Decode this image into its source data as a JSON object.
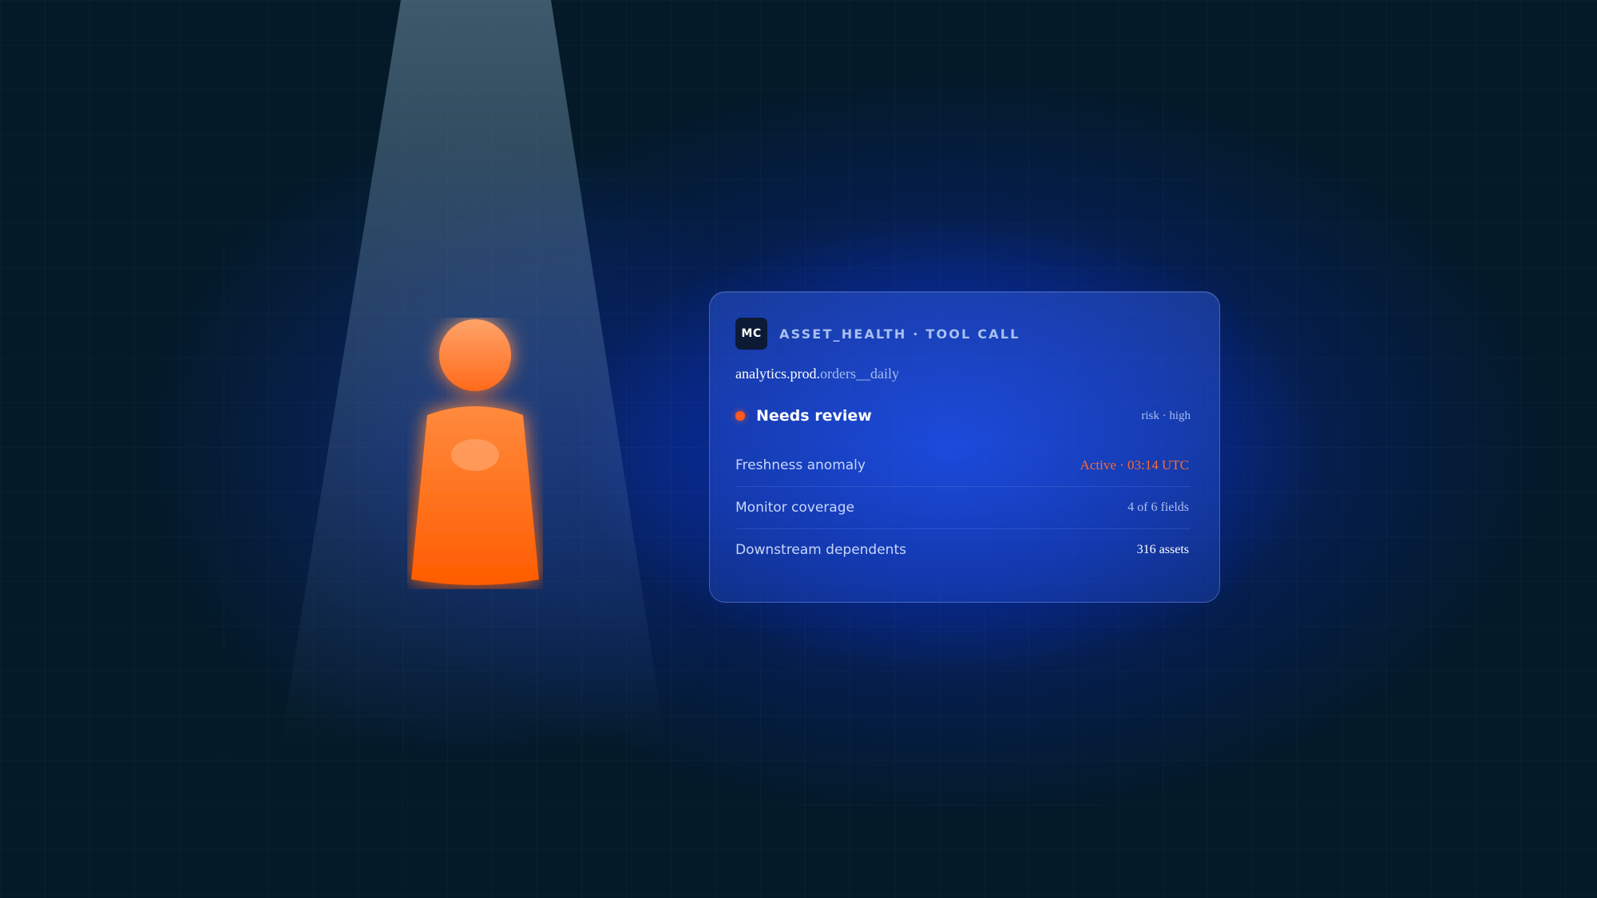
{
  "card": {
    "badge": "MC",
    "tool_title": "ASSET_HEALTH · TOOL CALL",
    "asset_prefix": "analytics.prod.",
    "asset_table": "orders__daily",
    "status": {
      "label": "Needs review",
      "risk": "risk · high",
      "dot_color": "#ff5a1f"
    },
    "rows": [
      {
        "label": "Freshness anomaly",
        "value": "Active · 03:14 UTC"
      },
      {
        "label": "Monitor coverage",
        "value": "4 of 6 fields"
      },
      {
        "label": "Downstream dependents",
        "value": "316 assets"
      }
    ]
  },
  "colors": {
    "accent_orange": "#ff6a1a",
    "background": "#041a28",
    "glow_blue": "#1446e6"
  }
}
